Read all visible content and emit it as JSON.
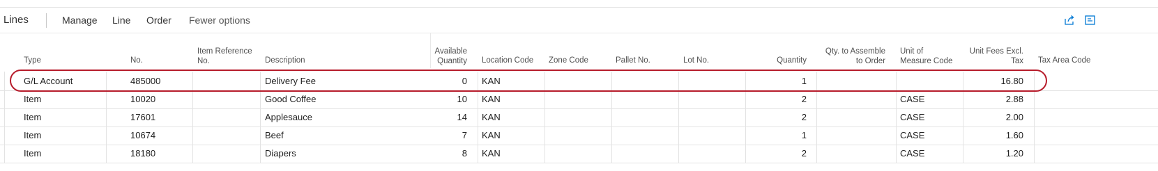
{
  "toolbar": {
    "title": "Lines",
    "actions": [
      "Manage",
      "Line",
      "Order",
      "Fewer options"
    ],
    "icons": [
      "share-icon",
      "expand-icon"
    ]
  },
  "columns": [
    {
      "key": "type",
      "label": "Type"
    },
    {
      "key": "no",
      "label": "No."
    },
    {
      "key": "item_ref",
      "label": "Item Reference No."
    },
    {
      "key": "description",
      "label": "Description"
    },
    {
      "key": "available_qty",
      "label": "Available Quantity"
    },
    {
      "key": "location",
      "label": "Location Code"
    },
    {
      "key": "zone",
      "label": "Zone Code"
    },
    {
      "key": "pallet",
      "label": "Pallet No."
    },
    {
      "key": "lot",
      "label": "Lot No."
    },
    {
      "key": "quantity",
      "label": "Quantity"
    },
    {
      "key": "qty_assemble",
      "label": "Qty. to Assemble to Order"
    },
    {
      "key": "uom",
      "label": "Unit of Measure Code"
    },
    {
      "key": "unit_fees",
      "label": "Unit Fees Excl. Tax"
    },
    {
      "key": "tax_area",
      "label": "Tax Area Code"
    }
  ],
  "rows": [
    {
      "type": "G/L Account",
      "no": "485000",
      "item_ref": "",
      "description": "Delivery Fee",
      "available_qty": "0",
      "location": "KAN",
      "zone": "",
      "pallet": "",
      "lot": "",
      "quantity": "1",
      "qty_assemble": "",
      "uom": "",
      "unit_fees": "16.80",
      "tax_area": ""
    },
    {
      "type": "Item",
      "no": "10020",
      "item_ref": "",
      "description": "Good Coffee",
      "available_qty": "10",
      "location": "KAN",
      "zone": "",
      "pallet": "",
      "lot": "",
      "quantity": "2",
      "qty_assemble": "",
      "uom": "CASE",
      "unit_fees": "2.88",
      "tax_area": ""
    },
    {
      "type": "Item",
      "no": "17601",
      "item_ref": "",
      "description": "Applesauce",
      "available_qty": "14",
      "location": "KAN",
      "zone": "",
      "pallet": "",
      "lot": "",
      "quantity": "2",
      "qty_assemble": "",
      "uom": "CASE",
      "unit_fees": "2.00",
      "tax_area": ""
    },
    {
      "type": "Item",
      "no": "10674",
      "item_ref": "",
      "description": "Beef",
      "available_qty": "7",
      "location": "KAN",
      "zone": "",
      "pallet": "",
      "lot": "",
      "quantity": "1",
      "qty_assemble": "",
      "uom": "CASE",
      "unit_fees": "1.60",
      "tax_area": ""
    },
    {
      "type": "Item",
      "no": "18180",
      "item_ref": "",
      "description": "Diapers",
      "available_qty": "8",
      "location": "KAN",
      "zone": "",
      "pallet": "",
      "lot": "",
      "quantity": "2",
      "qty_assemble": "",
      "uom": "CASE",
      "unit_fees": "1.20",
      "tax_area": ""
    }
  ],
  "colors": {
    "accent": "#0078d4",
    "highlight": "#b71c2b"
  }
}
